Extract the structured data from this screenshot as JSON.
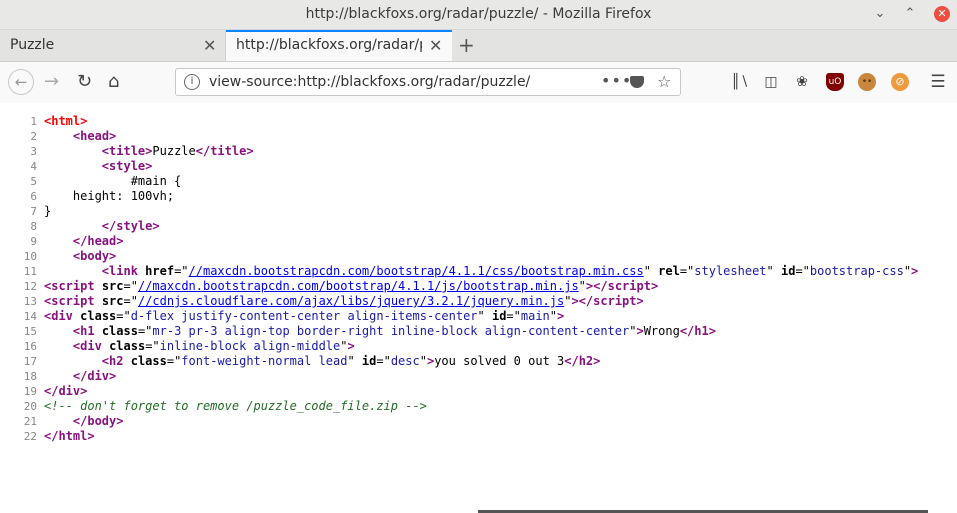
{
  "window": {
    "title": "http://blackfoxs.org/radar/puzzle/ - Mozilla Firefox"
  },
  "tabs": [
    {
      "label": "Puzzle"
    },
    {
      "label": "http://blackfoxs.org/radar/puzzle/"
    }
  ],
  "urlbar": {
    "url": "view-source:http://blackfoxs.org/radar/puzzle/",
    "page_actions": "•••"
  },
  "icons": {
    "back": "back-arrow-icon",
    "forward": "forward-arrow-icon",
    "reload": "reload-icon",
    "home": "home-icon",
    "info": "info-icon",
    "pocket": "pocket-icon",
    "star": "bookmark-star-icon",
    "library": "library-icon",
    "sidebar": "sidebar-icon",
    "gnome": "gnome-icon",
    "ublock": "ublock-origin-icon",
    "cookie": "cookie-icon",
    "noads": "no-ads-icon",
    "menu": "hamburger-menu-icon"
  },
  "colors": {
    "tag": "#881280",
    "attr": "#000000",
    "value": "#1a1aa6",
    "link": "#0000ee",
    "comment": "#236e25",
    "root": "#ff0000",
    "accent": "#0a84ff"
  },
  "source": {
    "lines": [
      [
        {
          "t": "<html>",
          "c": "root"
        }
      ],
      [
        {
          "t": "    "
        },
        {
          "t": "<",
          "c": "tag"
        },
        {
          "t": "head",
          "c": "tagname"
        },
        {
          "t": ">",
          "c": "tag"
        }
      ],
      [
        {
          "t": "        "
        },
        {
          "t": "<",
          "c": "tag"
        },
        {
          "t": "title",
          "c": "tagname"
        },
        {
          "t": ">",
          "c": "tag"
        },
        {
          "t": "Puzzle"
        },
        {
          "t": "</",
          "c": "tag"
        },
        {
          "t": "title",
          "c": "tagname"
        },
        {
          "t": ">",
          "c": "tag"
        }
      ],
      [
        {
          "t": "        "
        },
        {
          "t": "<",
          "c": "tag"
        },
        {
          "t": "style",
          "c": "tagname"
        },
        {
          "t": ">",
          "c": "tag"
        }
      ],
      [
        {
          "t": "            #main {"
        }
      ],
      [
        {
          "t": "    height: 100vh;"
        }
      ],
      [
        {
          "t": "}"
        }
      ],
      [
        {
          "t": "        "
        },
        {
          "t": "</",
          "c": "tag"
        },
        {
          "t": "style",
          "c": "tagname"
        },
        {
          "t": ">",
          "c": "tag"
        }
      ],
      [
        {
          "t": "    "
        },
        {
          "t": "</",
          "c": "tag"
        },
        {
          "t": "head",
          "c": "tagname"
        },
        {
          "t": ">",
          "c": "tag"
        }
      ],
      [
        {
          "t": "    "
        },
        {
          "t": "<",
          "c": "tag"
        },
        {
          "t": "body",
          "c": "tagname"
        },
        {
          "t": ">",
          "c": "tag"
        }
      ],
      [
        {
          "t": "        "
        },
        {
          "t": "<",
          "c": "tag"
        },
        {
          "t": "link",
          "c": "tagname"
        },
        {
          "t": " "
        },
        {
          "t": "href",
          "c": "attr"
        },
        {
          "t": "=\""
        },
        {
          "t": "//maxcdn.bootstrapcdn.com/bootstrap/4.1.1/css/bootstrap.min.css",
          "c": "link"
        },
        {
          "t": "\" "
        },
        {
          "t": "rel",
          "c": "attr"
        },
        {
          "t": "=\""
        },
        {
          "t": "stylesheet",
          "c": "value"
        },
        {
          "t": "\" "
        },
        {
          "t": "id",
          "c": "attr"
        },
        {
          "t": "=\""
        },
        {
          "t": "bootstrap-css",
          "c": "value"
        },
        {
          "t": "\""
        },
        {
          "t": ">",
          "c": "tag"
        }
      ],
      [
        {
          "t": "<",
          "c": "tag"
        },
        {
          "t": "script",
          "c": "tagname"
        },
        {
          "t": " "
        },
        {
          "t": "src",
          "c": "attr"
        },
        {
          "t": "=\""
        },
        {
          "t": "//maxcdn.bootstrapcdn.com/bootstrap/4.1.1/js/bootstrap.min.js",
          "c": "link"
        },
        {
          "t": "\""
        },
        {
          "t": ">",
          "c": "tag"
        },
        {
          "t": "</",
          "c": "tag"
        },
        {
          "t": "script",
          "c": "tagname"
        },
        {
          "t": ">",
          "c": "tag"
        }
      ],
      [
        {
          "t": "<",
          "c": "tag"
        },
        {
          "t": "script",
          "c": "tagname"
        },
        {
          "t": " "
        },
        {
          "t": "src",
          "c": "attr"
        },
        {
          "t": "=\""
        },
        {
          "t": "//cdnjs.cloudflare.com/ajax/libs/jquery/3.2.1/jquery.min.js",
          "c": "link"
        },
        {
          "t": "\""
        },
        {
          "t": ">",
          "c": "tag"
        },
        {
          "t": "</",
          "c": "tag"
        },
        {
          "t": "script",
          "c": "tagname"
        },
        {
          "t": ">",
          "c": "tag"
        }
      ],
      [
        {
          "t": "<",
          "c": "tag"
        },
        {
          "t": "div",
          "c": "tagname"
        },
        {
          "t": " "
        },
        {
          "t": "class",
          "c": "attr"
        },
        {
          "t": "=\""
        },
        {
          "t": "d-flex justify-content-center align-items-center",
          "c": "value"
        },
        {
          "t": "\" "
        },
        {
          "t": "id",
          "c": "attr"
        },
        {
          "t": "=\""
        },
        {
          "t": "main",
          "c": "value"
        },
        {
          "t": "\""
        },
        {
          "t": ">",
          "c": "tag"
        }
      ],
      [
        {
          "t": "    "
        },
        {
          "t": "<",
          "c": "tag"
        },
        {
          "t": "h1",
          "c": "tagname"
        },
        {
          "t": " "
        },
        {
          "t": "class",
          "c": "attr"
        },
        {
          "t": "=\""
        },
        {
          "t": "mr-3 pr-3 align-top border-right inline-block align-content-center",
          "c": "value"
        },
        {
          "t": "\""
        },
        {
          "t": ">",
          "c": "tag"
        },
        {
          "t": "Wrong"
        },
        {
          "t": "</",
          "c": "tag"
        },
        {
          "t": "h1",
          "c": "tagname"
        },
        {
          "t": ">",
          "c": "tag"
        }
      ],
      [
        {
          "t": "    "
        },
        {
          "t": "<",
          "c": "tag"
        },
        {
          "t": "div",
          "c": "tagname"
        },
        {
          "t": " "
        },
        {
          "t": "class",
          "c": "attr"
        },
        {
          "t": "=\""
        },
        {
          "t": "inline-block align-middle",
          "c": "value"
        },
        {
          "t": "\""
        },
        {
          "t": ">",
          "c": "tag"
        }
      ],
      [
        {
          "t": "        "
        },
        {
          "t": "<",
          "c": "tag"
        },
        {
          "t": "h2",
          "c": "tagname"
        },
        {
          "t": " "
        },
        {
          "t": "class",
          "c": "attr"
        },
        {
          "t": "=\""
        },
        {
          "t": "font-weight-normal lead",
          "c": "value"
        },
        {
          "t": "\" "
        },
        {
          "t": "id",
          "c": "attr"
        },
        {
          "t": "=\""
        },
        {
          "t": "desc",
          "c": "value"
        },
        {
          "t": "\""
        },
        {
          "t": ">",
          "c": "tag"
        },
        {
          "t": "you solved 0 out 3"
        },
        {
          "t": "</",
          "c": "tag"
        },
        {
          "t": "h2",
          "c": "tagname"
        },
        {
          "t": ">",
          "c": "tag"
        }
      ],
      [
        {
          "t": "    "
        },
        {
          "t": "</",
          "c": "tag"
        },
        {
          "t": "div",
          "c": "tagname"
        },
        {
          "t": ">",
          "c": "tag"
        }
      ],
      [
        {
          "t": "</",
          "c": "tag"
        },
        {
          "t": "div",
          "c": "tagname"
        },
        {
          "t": ">",
          "c": "tag"
        }
      ],
      [
        {
          "t": "<!-- don't forget to remove /puzzle_code_file.zip -->",
          "c": "comment"
        }
      ],
      [
        {
          "t": "    "
        },
        {
          "t": "</",
          "c": "tag"
        },
        {
          "t": "body",
          "c": "tagname"
        },
        {
          "t": ">",
          "c": "tag"
        }
      ],
      [
        {
          "t": "</",
          "c": "tag"
        },
        {
          "t": "html",
          "c": "tagname"
        },
        {
          "t": ">",
          "c": "tag"
        }
      ]
    ]
  }
}
